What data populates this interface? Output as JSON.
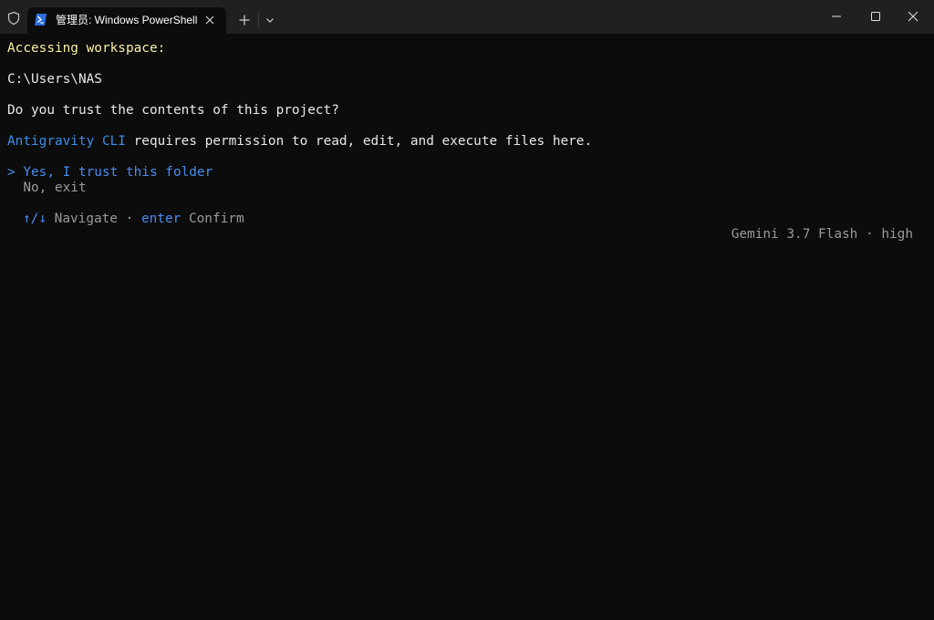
{
  "window": {
    "tab_title": "管理员: Windows PowerShell",
    "icons": {
      "admin": "shield-icon",
      "app": "powershell-icon",
      "tab_close": "close-icon",
      "new_tab": "plus-icon",
      "dropdown": "chevron-down-icon",
      "minimize": "minimize-icon",
      "maximize": "maximize-icon",
      "close": "close-icon"
    }
  },
  "terminal": {
    "heading": "Accessing workspace:",
    "path": "C:\\Users\\NAS",
    "question": "Do you trust the contents of this project?",
    "app_name": "Antigravity CLI",
    "permission_text": " requires permission to read, edit, and execute files here.",
    "options": [
      {
        "prefix": "> ",
        "label": "Yes, I trust this folder",
        "selected": true
      },
      {
        "prefix": "  ",
        "label": "No, exit",
        "selected": false
      }
    ],
    "hint": {
      "nav_keys": "↑/↓",
      "nav_label": " Navigate · ",
      "confirm_key": "enter",
      "confirm_label": " Confirm"
    },
    "model_status": "Gemini 3.7 Flash · high"
  },
  "colors": {
    "background": "#0c0c0c",
    "titlebar": "#202020",
    "heading": "#f9f1a5",
    "accent": "#3b8eea",
    "muted": "#9a9a9a"
  }
}
